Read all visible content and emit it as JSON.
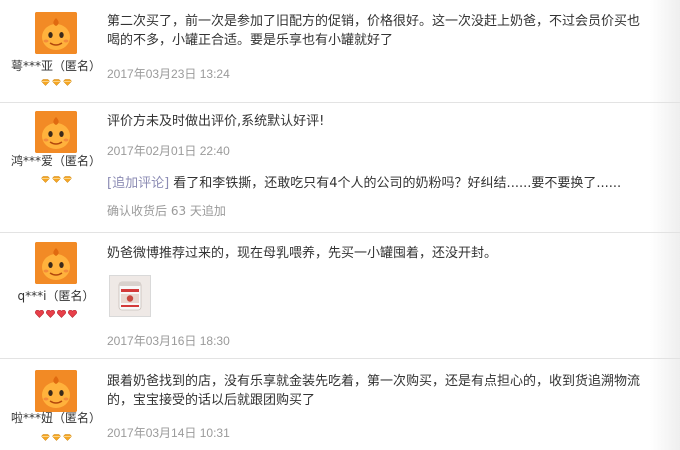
{
  "reviews": [
    {
      "user": "萼***亚（匿名）",
      "badge_type": "diamond-gold",
      "badge_count": 3,
      "lines": [
        "第二次买了，前一次是参加了旧配方的促销，价格很好。这一次没赶上奶爸，不过会员价买也",
        "喝的不多，小罐正合适。要是乐享也有小罐就好了"
      ],
      "date": "2017年03月23日 13:24"
    },
    {
      "user": "鸿***爱（匿名）",
      "badge_type": "diamond-gold",
      "badge_count": 3,
      "lines": [
        "评价方未及时做出评价,系统默认好评!"
      ],
      "date": "2017年02月01日 22:40",
      "append": {
        "label": "[追加评论]",
        "text": " 看了和李铁撕，还敢吃只有4个人的公司的奶粉吗？好纠结......要不要换了......",
        "meta": "确认收货后 63 天追加"
      }
    },
    {
      "user": "q***i（匿名）",
      "badge_type": "heart-red",
      "badge_count": 4,
      "lines": [
        "奶爸微博推荐过来的，现在母乳喂养，先买一小罐囤着，还没开封。"
      ],
      "photo": "product-photo",
      "date": "2017年03月16日 18:30"
    },
    {
      "user": "啦***妞（匿名）",
      "badge_type": "diamond-gold",
      "badge_count": 3,
      "lines": [
        "跟着奶爸找到的店，没有乐享就金装先吃着，第一次购买，还是有点担心的，收到货追溯物流",
        "的，宝宝接受的话以后就跟团购买了"
      ],
      "date": "2017年03月14日 10:31"
    }
  ],
  "colors": {
    "avatar": "#f28a25",
    "badge_gold": "#f5a623",
    "badge_red": "#e8404a",
    "text": "#333333",
    "date": "#9a9a9a",
    "append_label": "#8c8cb4"
  }
}
